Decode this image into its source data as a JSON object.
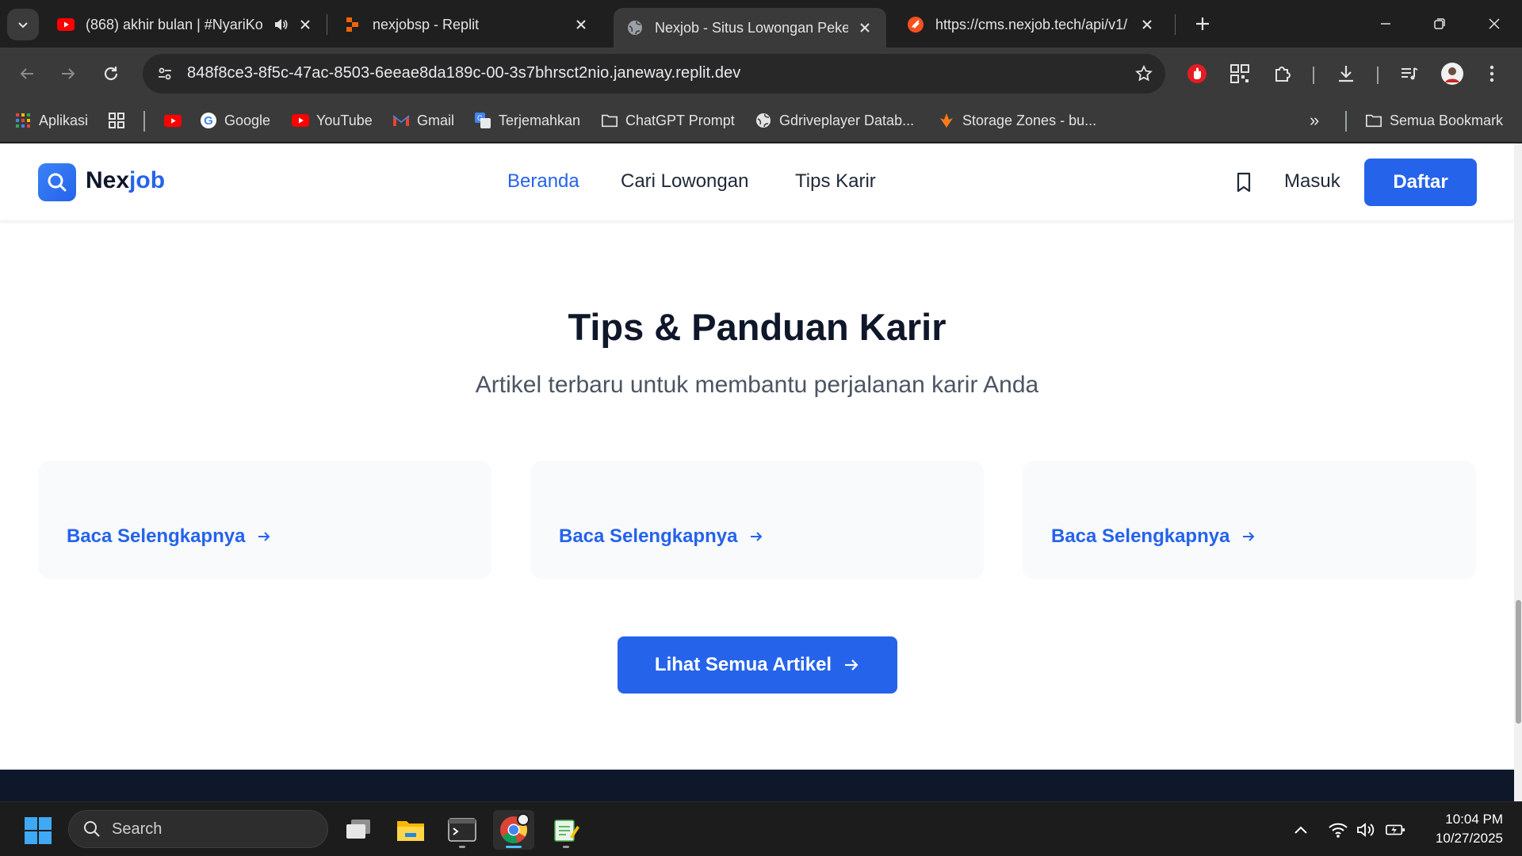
{
  "browser": {
    "tabs": [
      {
        "title": "(868) akhir bulan | #NyariKo",
        "icon": "youtube-icon"
      },
      {
        "title": "nexjobsp - Replit",
        "icon": "replit-icon"
      },
      {
        "title": "Nexjob - Situs Lowongan Pekerj",
        "icon": "globe-icon",
        "active": true
      },
      {
        "title": "https://cms.nexjob.tech/api/v1/",
        "icon": "cms-icon"
      }
    ],
    "url": "848f8ce3-8f5c-47ac-8503-6eeae8da189c-00-3s7bhrsct2nio.janeway.replit.dev",
    "bookmarks": [
      {
        "label": "Aplikasi",
        "icon": "apps-grid-icon"
      },
      {
        "label": "",
        "icon": "bookmark-grid-icon"
      },
      {
        "label": "",
        "icon": "youtube-icon"
      },
      {
        "label": "Google",
        "icon": "google-icon"
      },
      {
        "label": "YouTube",
        "icon": "youtube-icon"
      },
      {
        "label": "Gmail",
        "icon": "gmail-icon"
      },
      {
        "label": "Terjemahkan",
        "icon": "translate-icon"
      },
      {
        "label": "ChatGPT Prompt",
        "icon": "folder-icon"
      },
      {
        "label": "Gdriveplayer Datab...",
        "icon": "globe-icon"
      },
      {
        "label": "Storage Zones - bu...",
        "icon": "bunny-icon"
      }
    ],
    "all_bookmarks_label": "Semua Bookmark",
    "more_bookmarks": "»"
  },
  "site": {
    "logo": {
      "part1": "Nex",
      "part2": "job"
    },
    "nav": [
      {
        "label": "Beranda",
        "active": true
      },
      {
        "label": "Cari Lowongan",
        "active": false
      },
      {
        "label": "Tips Karir",
        "active": false
      }
    ],
    "login_label": "Masuk",
    "signup_label": "Daftar",
    "accent_color": "#2563eb"
  },
  "section": {
    "title": "Tips & Panduan Karir",
    "subtitle": "Artikel terbaru untuk membantu perjalanan karir Anda",
    "cards": [
      {
        "link_label": "Baca Selengkapnya"
      },
      {
        "link_label": "Baca Selengkapnya"
      },
      {
        "link_label": "Baca Selengkapnya"
      }
    ],
    "all_articles_label": "Lihat Semua Artikel"
  },
  "taskbar": {
    "search_label": "Search",
    "apps": [
      "task-view-icon",
      "file-explorer-icon",
      "terminal-icon",
      "chrome-icon",
      "notepad-icon"
    ],
    "time": "10:04 PM",
    "date": "10/27/2025"
  }
}
